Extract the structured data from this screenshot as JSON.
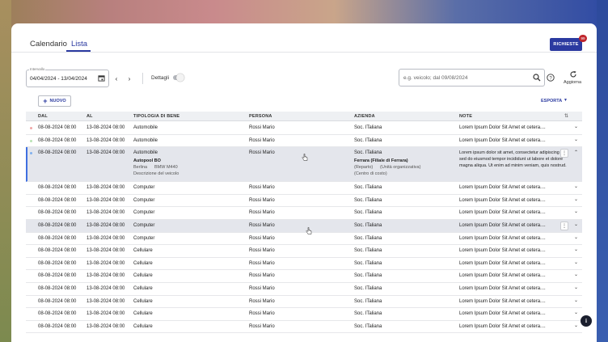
{
  "tabs": [
    {
      "label": "Calendario",
      "active": false
    },
    {
      "label": "Lista",
      "active": true
    }
  ],
  "requests": {
    "label": "RICHIESTE",
    "badge": "99"
  },
  "toolbar": {
    "interval_label": "Intervallo",
    "interval_value": "04/04/2024 - 13/04/2024",
    "details_label": "Dettagli",
    "details_on": false,
    "search_placeholder": "e.g. veicolo; dal 09/08/2024",
    "refresh_label": "Aggiorna"
  },
  "actions": {
    "new_label": "NUOVO",
    "export_label": "ESPORTA"
  },
  "columns": [
    "DAL",
    "AL",
    "TIPOLOGIA DI BENE",
    "PERSONA",
    "AZIENDA",
    "NOTE"
  ],
  "expanded_row": {
    "dal": "08-08-2024 08:00",
    "al": "13-08-2024 08:00",
    "tipologia": "Automobile",
    "persona": "Rossi Mario",
    "azienda": "Soc. ITaliana",
    "asset_name": "Autopool BO",
    "asset_tag1": "Berlina",
    "asset_tag2": "BMW M440",
    "asset_desc": "Descrizione del veicolo",
    "company_unit": "Ferrara (Filiale di Ferrara)",
    "reparto": "(Reparto)",
    "unita": "(Unità organizzativa)",
    "centro": "(Centro di costo)",
    "note": "Lorem ipsum dolor sit amet, consectetur adipiscing elit, sed do eiusmod tempor incididunt ut labore et dolore magna aliqua. Ut enim ad minim veniam, quis nostrud."
  },
  "rows": [
    {
      "dal": "08-08-2024 08:00",
      "al": "13-08-2024 08:00",
      "tipologia": "Automobile",
      "persona": "Rossi Mario",
      "azienda": "Soc. ITaliana",
      "note": "Lorem Ipsum Dolor Sit Amet et cetera....",
      "dot": "#f0a6a6"
    },
    {
      "dal": "08-08-2024 08:00",
      "al": "13-08-2024 08:00",
      "tipologia": "Automobile",
      "persona": "Rossi Mario",
      "azienda": "Soc. ITaliana",
      "note": "Lorem Ipsum Dolor Sit Amet et cetera....",
      "dot": "#b9e3b4"
    },
    {
      "dal": "08-08-2024 08:00",
      "al": "13-08-2024 08:00",
      "tipologia": "Computer",
      "persona": "Rossi Mario",
      "azienda": "Soc. ITaliana",
      "note": "Lorem Ipsum Dolor Sit Amet et cetera...."
    },
    {
      "dal": "08-08-2024 08:00",
      "al": "13-08-2024 08:00",
      "tipologia": "Computer",
      "persona": "Rossi Mario",
      "azienda": "Soc. ITaliana",
      "note": "Lorem Ipsum Dolor Sit Amet et cetera...."
    },
    {
      "dal": "08-08-2024 08:00",
      "al": "13-08-2024 08:00",
      "tipologia": "Computer",
      "persona": "Rossi Mario",
      "azienda": "Soc. ITaliana",
      "note": "Lorem Ipsum Dolor Sit Amet et cetera...."
    },
    {
      "dal": "08-08-2024 08:00",
      "al": "13-08-2024 08:00",
      "tipologia": "Computer",
      "persona": "Rossi Mario",
      "azienda": "Soc. ITaliana",
      "note": "Lorem Ipsum Dolor Sit Amet et cetera....",
      "selected": true
    },
    {
      "dal": "08-08-2024 08:00",
      "al": "13-08-2024 08:00",
      "tipologia": "Computer",
      "persona": "Rossi Mario",
      "azienda": "Soc. ITaliana",
      "note": "Lorem Ipsum Dolor Sit Amet et cetera...."
    },
    {
      "dal": "08-08-2024 08:00",
      "al": "13-08-2024 08:00",
      "tipologia": "Cellulare",
      "persona": "Rossi Mario",
      "azienda": "Soc. ITaliana",
      "note": "Lorem Ipsum Dolor Sit Amet et cetera...."
    },
    {
      "dal": "08-08-2024 08:00",
      "al": "13-08-2024 08:00",
      "tipologia": "Cellulare",
      "persona": "Rossi Mario",
      "azienda": "Soc. ITaliana",
      "note": "Lorem Ipsum Dolor Sit Amet et cetera...."
    },
    {
      "dal": "08-08-2024 08:00",
      "al": "13-08-2024 08:00",
      "tipologia": "Cellulare",
      "persona": "Rossi Mario",
      "azienda": "Soc. ITaliana",
      "note": "Lorem Ipsum Dolor Sit Amet et cetera...."
    },
    {
      "dal": "08-08-2024 08:00",
      "al": "13-08-2024 08:00",
      "tipologia": "Cellulare",
      "persona": "Rossi Mario",
      "azienda": "Soc. ITaliana",
      "note": "Lorem Ipsum Dolor Sit Amet et cetera...."
    },
    {
      "dal": "08-08-2024 08:00",
      "al": "13-08-2024 08:00",
      "tipologia": "Cellulare",
      "persona": "Rossi Mario",
      "azienda": "Soc. ITaliana",
      "note": "Lorem Ipsum Dolor Sit Amet et cetera...."
    },
    {
      "dal": "08-08-2024 08:00",
      "al": "13-08-2024 08:00",
      "tipologia": "Cellulare",
      "persona": "Rossi Mario",
      "azienda": "Soc. ITaliana",
      "note": "Lorem Ipsum Dolor Sit Amet et cetera...."
    },
    {
      "dal": "08-08-2024 08:00",
      "al": "13-08-2024 08:00",
      "tipologia": "Cellulare",
      "persona": "Rossi Mario",
      "azienda": "Soc. ITaliana",
      "note": "Lorem Ipsum Dolor Sit Amet et cetera...."
    }
  ]
}
